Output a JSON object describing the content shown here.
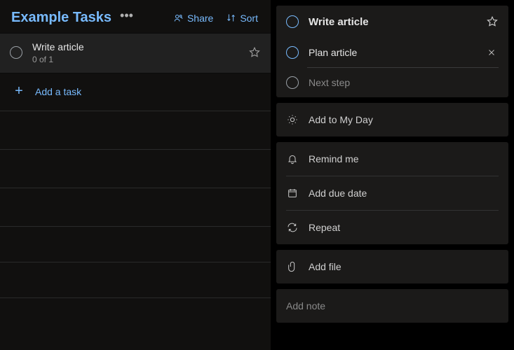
{
  "list": {
    "title": "Example Tasks",
    "share_label": "Share",
    "sort_label": "Sort",
    "add_task_placeholder": "Add a task"
  },
  "tasks": [
    {
      "title": "Write article",
      "subtitle": "0 of 1"
    }
  ],
  "detail": {
    "title": "Write article",
    "steps": [
      {
        "label": "Plan article"
      }
    ],
    "next_step_placeholder": "Next step",
    "add_to_my_day": "Add to My Day",
    "remind_me": "Remind me",
    "add_due_date": "Add due date",
    "repeat": "Repeat",
    "add_file": "Add file",
    "add_note_placeholder": "Add note"
  }
}
